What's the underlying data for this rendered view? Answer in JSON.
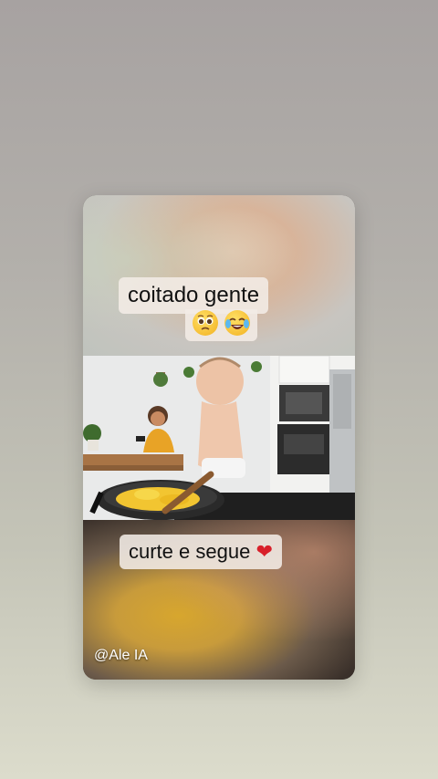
{
  "caption_top": {
    "text": "coitado gente",
    "emoji": [
      "pleading-face",
      "tears-of-joy-face"
    ]
  },
  "caption_bottom": {
    "text": "curte e segue",
    "emoji": "heart"
  },
  "watermark": "@Ale IA",
  "colors": {
    "caption_bg": "#f3ece6",
    "heart": "#d81f2a"
  }
}
